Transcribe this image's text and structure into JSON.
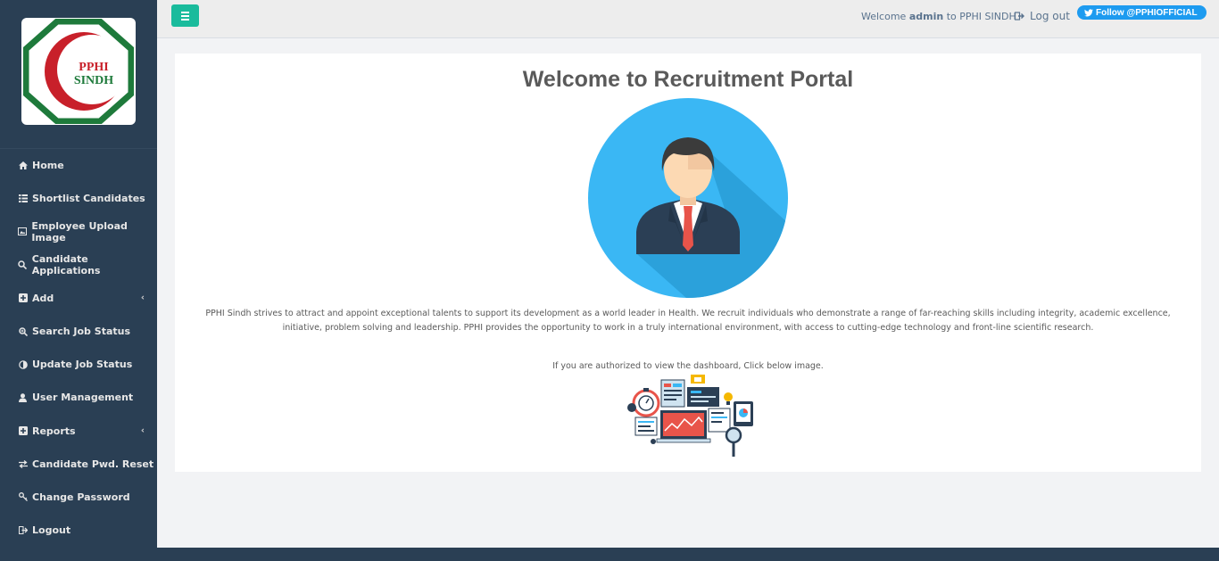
{
  "logo": {
    "line1": "PPHI",
    "line2": "SINDH"
  },
  "sidebar": {
    "items": [
      {
        "label": "Home",
        "icon": "home-icon",
        "has_caret": false
      },
      {
        "label": "Shortlist Candidates",
        "icon": "list-icon",
        "has_caret": false
      },
      {
        "label": "Employee Upload Image",
        "icon": "image-icon",
        "has_caret": false
      },
      {
        "label": "Candidate Applications",
        "icon": "search-icon",
        "has_caret": false
      },
      {
        "label": "Add",
        "icon": "plus-square-icon",
        "has_caret": true
      },
      {
        "label": "Search Job Status",
        "icon": "search-plus-icon",
        "has_caret": false
      },
      {
        "label": "Update Job Status",
        "icon": "adjust-icon",
        "has_caret": false
      },
      {
        "label": "User Management",
        "icon": "user-icon",
        "has_caret": false
      },
      {
        "label": "Reports",
        "icon": "plus-square-icon",
        "has_caret": true
      },
      {
        "label": "Candidate Pwd. Reset",
        "icon": "exchange-icon",
        "has_caret": false
      },
      {
        "label": "Change Password",
        "icon": "key-icon",
        "has_caret": false
      },
      {
        "label": "Logout",
        "icon": "sign-out-icon",
        "has_caret": false
      }
    ],
    "caret": "‹"
  },
  "topnav": {
    "welcome_prefix": "Welcome",
    "username": "admin",
    "welcome_suffix": "to PPHI SINDH",
    "logout_label": "Log out",
    "twitter_label": "Follow @PPHIOFFICIAL"
  },
  "main": {
    "title": "Welcome to Recruitment Portal",
    "about": "PPHI Sindh strives to attract and appoint exceptional talents to support its development as a world leader in Health. We recruit individuals who demonstrate a range of far-reaching skills including integrity, academic excellence, initiative, problem solving and leadership. PPHI provides the opportunity to work in a truly international environment, with access to cutting-edge technology and front-line scientific research.",
    "auth_note": "If you are authorized to view the dashboard, Click below image."
  },
  "colors": {
    "sidebar_bg": "#2a3f54",
    "accent": "#1abb9c",
    "twitter": "#1d9bf0",
    "avatar_circle": "#3db8f5"
  }
}
